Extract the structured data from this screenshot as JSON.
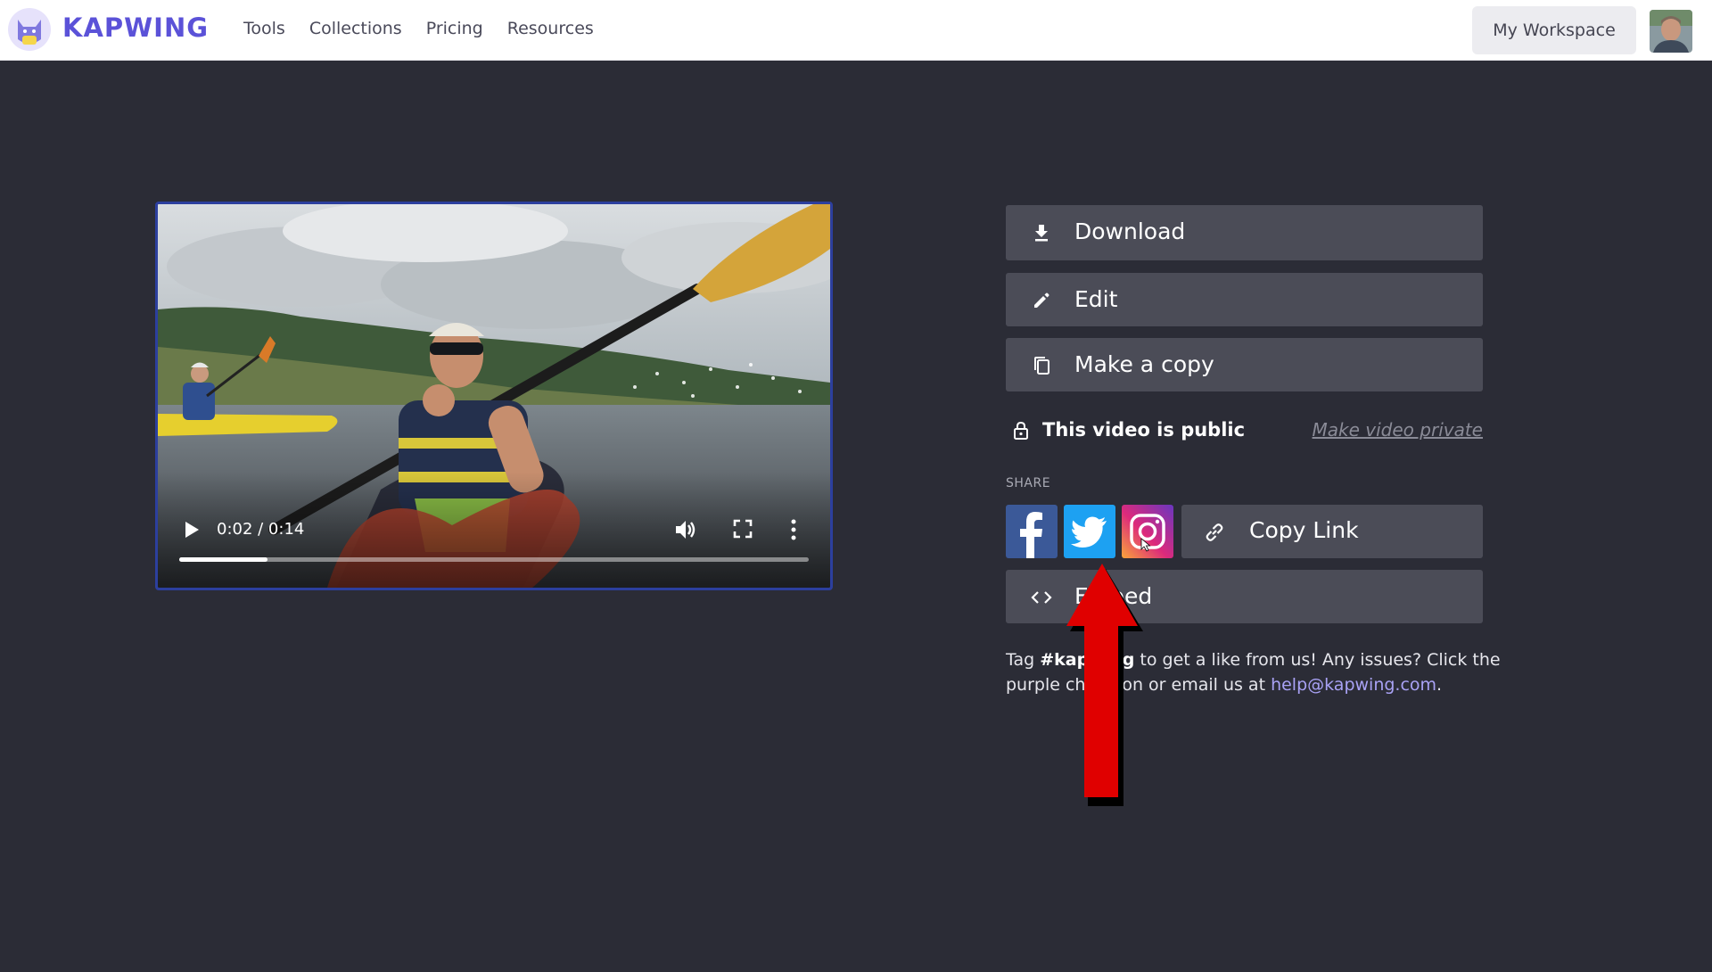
{
  "header": {
    "brand": "KAPWING",
    "nav": [
      "Tools",
      "Collections",
      "Pricing",
      "Resources"
    ],
    "workspace_label": "My Workspace",
    "brand_color": "#5b52d8"
  },
  "video": {
    "time": "0:02 / 0:14",
    "progress_fraction": 0.14,
    "border_color": "#2c3f9e"
  },
  "actions": {
    "download": "Download",
    "edit": "Edit",
    "copy": "Make a copy"
  },
  "visibility": {
    "status": "This video is public",
    "toggle_link": "Make video private"
  },
  "share": {
    "label": "SHARE",
    "copy_link": "Copy Link",
    "embed": "Embed",
    "icons": [
      "facebook-icon",
      "twitter-icon",
      "instagram-icon"
    ]
  },
  "footer": {
    "tag_prefix": "Tag ",
    "hashtag": "#kapwing",
    "line1_rest": " to get a like from us! Any issues? Click the",
    "line2": "purple chat icon or email us at ",
    "email": "help@kapwing.com",
    "period": "."
  },
  "annotation": {
    "arrow_color": "#e00000"
  }
}
